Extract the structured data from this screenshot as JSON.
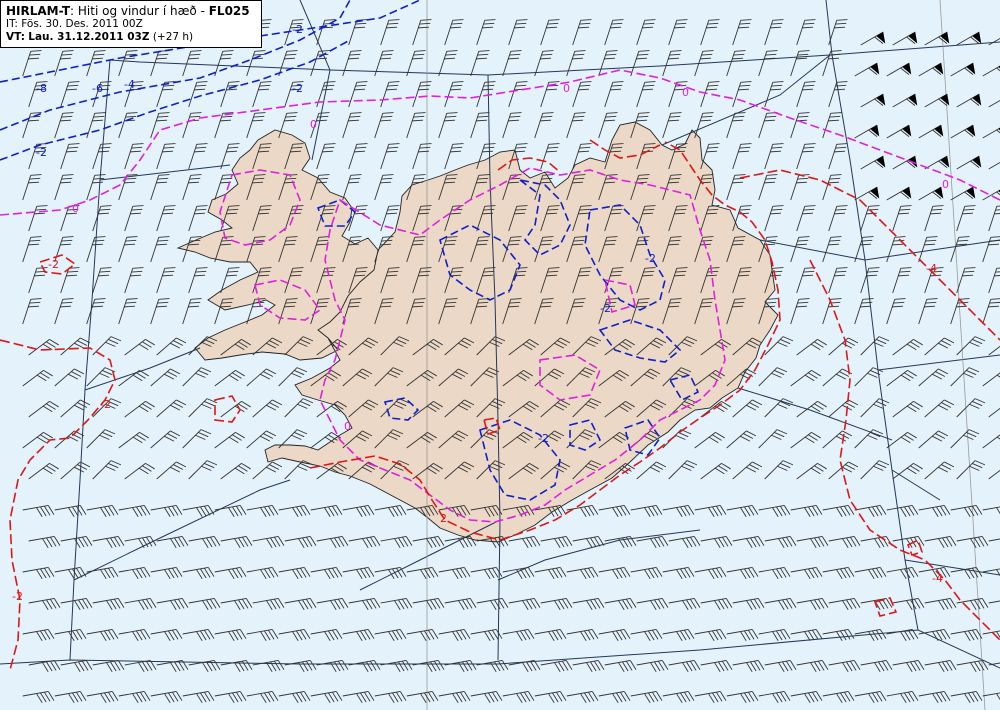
{
  "header": {
    "model": "HIRLAM-T",
    "title": ": Hiti og vindur í hæð - ",
    "level": "FL025",
    "it_label": "IT: Fös. 30. Des. 2011 00Z",
    "vt_label": "VT:",
    "vt_date": "Lau. 31.12.2011 03Z",
    "vt_offset": "(+27 h)"
  },
  "contour_labels": {
    "blue": [
      "-2",
      "-8",
      "-6",
      "-4",
      "-2",
      "-2",
      "-2",
      "-2",
      "-2"
    ],
    "magenta": [
      "0",
      "0",
      "0",
      "0",
      "0",
      "0"
    ],
    "red": [
      "-2",
      "-2",
      "2",
      "-2",
      "-4",
      "-4"
    ]
  },
  "colors": {
    "sea": "#e3f2fb",
    "land": "#ecd8c6",
    "coast": "#222222",
    "grid": "#24365a",
    "meridian": "#9a9a9a",
    "contour_negative": "#1020c8",
    "contour_zero": "#e020e0",
    "contour_positive": "#dd1818",
    "barb": "#333333"
  }
}
